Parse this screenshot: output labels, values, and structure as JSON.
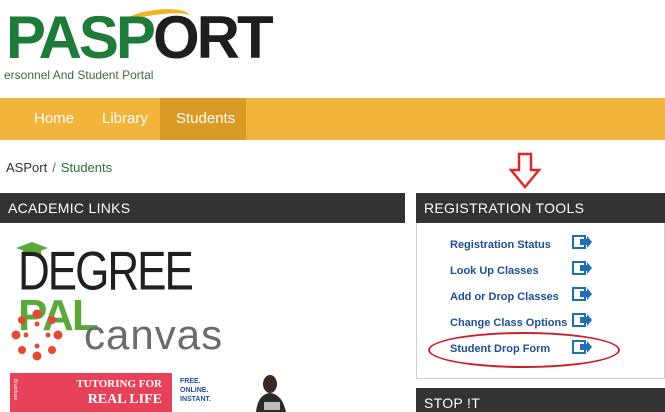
{
  "header": {
    "logo_text_1": "PAS",
    "logo_text_2": "P",
    "logo_text_3": "ORT",
    "logo_subtitle": "ersonnel And Student Portal"
  },
  "nav": {
    "items": [
      {
        "label": "Home"
      },
      {
        "label": "Library"
      },
      {
        "label": "Students"
      }
    ],
    "active": "Students"
  },
  "breadcrumb": {
    "root": "ASPort",
    "separator": "/",
    "current": "Students"
  },
  "academic_links": {
    "title": "ACADEMIC LINKS",
    "degreepal": {
      "part1": "DEGREE",
      "part2": "PAL"
    },
    "canvas": {
      "label": "canvas"
    },
    "tutoring": {
      "side_text": "Brainfuse",
      "line1": "TUTORING FOR",
      "line2": "REAL LIFE",
      "tagline_1": "FREE.",
      "tagline_2": "ONLINE.",
      "tagline_3": "INSTANT."
    }
  },
  "registration_tools": {
    "title": "REGISTRATION TOOLS",
    "items": [
      {
        "label": "Registration Status"
      },
      {
        "label": "Look Up Classes"
      },
      {
        "label": "Add or Drop Classes"
      },
      {
        "label": "Change Class Options"
      },
      {
        "label": "Student Drop Form"
      }
    ]
  },
  "stop_it": {
    "title": "STOP !T"
  },
  "colors": {
    "nav_bg": "#f2b43a",
    "nav_active": "#d99b24",
    "panel_header": "#333333",
    "link_blue": "#1f4e96",
    "highlight_red": "#cc1f2a",
    "brand_green": "#1e7b3a"
  }
}
